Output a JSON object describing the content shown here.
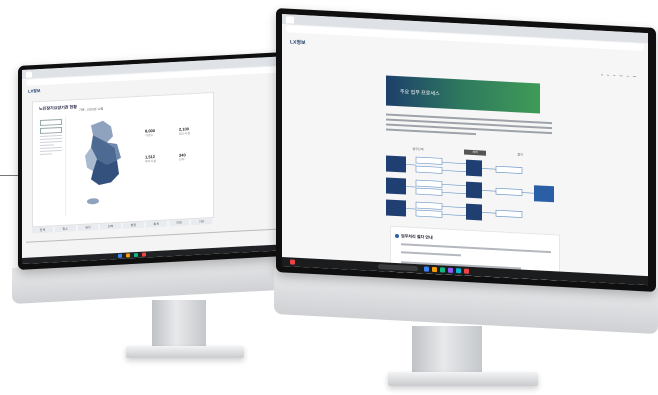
{
  "left_screen": {
    "logo": "LX정보",
    "panel_title": "노인장기요양기관 현황",
    "panel_subtitle": "기준 : 2023년 12월",
    "stats": [
      {
        "value": "8,000",
        "label": "기관수"
      },
      {
        "value": "2,100",
        "label": "입소시설"
      },
      {
        "value": "1,512",
        "label": "재가시설"
      },
      {
        "value": "340",
        "label": "인력"
      }
    ],
    "tabs": [
      "전체",
      "입소",
      "재가",
      "인력",
      "현황",
      "통계",
      "지역",
      "기타"
    ]
  },
  "right_screen": {
    "logo": "LX정보",
    "banner_title": "주요 업무 프로세스",
    "legend": [
      "업무단계",
      "처리",
      "결과"
    ],
    "card_heading": "업무처리 절차 안내"
  },
  "colors": {
    "navy": "#1f3f72",
    "blue": "#2a5fa6",
    "banner_start": "#1d3f6b",
    "banner_end": "#3f9b57"
  }
}
